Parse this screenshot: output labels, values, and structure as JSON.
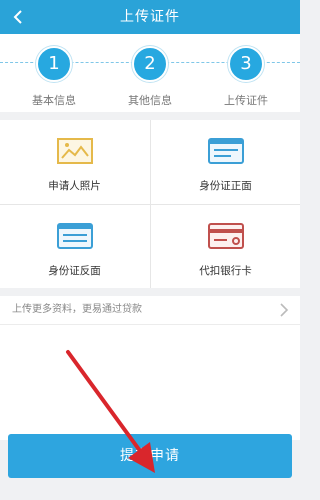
{
  "header": {
    "title": "上传证件",
    "back_icon": "chevron-left-icon"
  },
  "steps": [
    {
      "number": "1",
      "label": "基本信息"
    },
    {
      "number": "2",
      "label": "其他信息"
    },
    {
      "number": "3",
      "label": "上传证件"
    }
  ],
  "documents": [
    {
      "label": "申请人照片",
      "icon": "photo-icon"
    },
    {
      "label": "身份证正面",
      "icon": "id-card-front-icon"
    },
    {
      "label": "身份证反面",
      "icon": "id-card-back-icon"
    },
    {
      "label": "代扣银行卡",
      "icon": "bank-card-icon"
    }
  ],
  "more": {
    "text": "上传更多资料，更易通过贷款"
  },
  "submit": {
    "label": "提交申请"
  },
  "colors": {
    "accent": "#2aa3d8",
    "gold": "#e5b94a",
    "blue_icon": "#3b9fd6",
    "red_icon": "#c0504d",
    "arrow": "#d9262c"
  }
}
